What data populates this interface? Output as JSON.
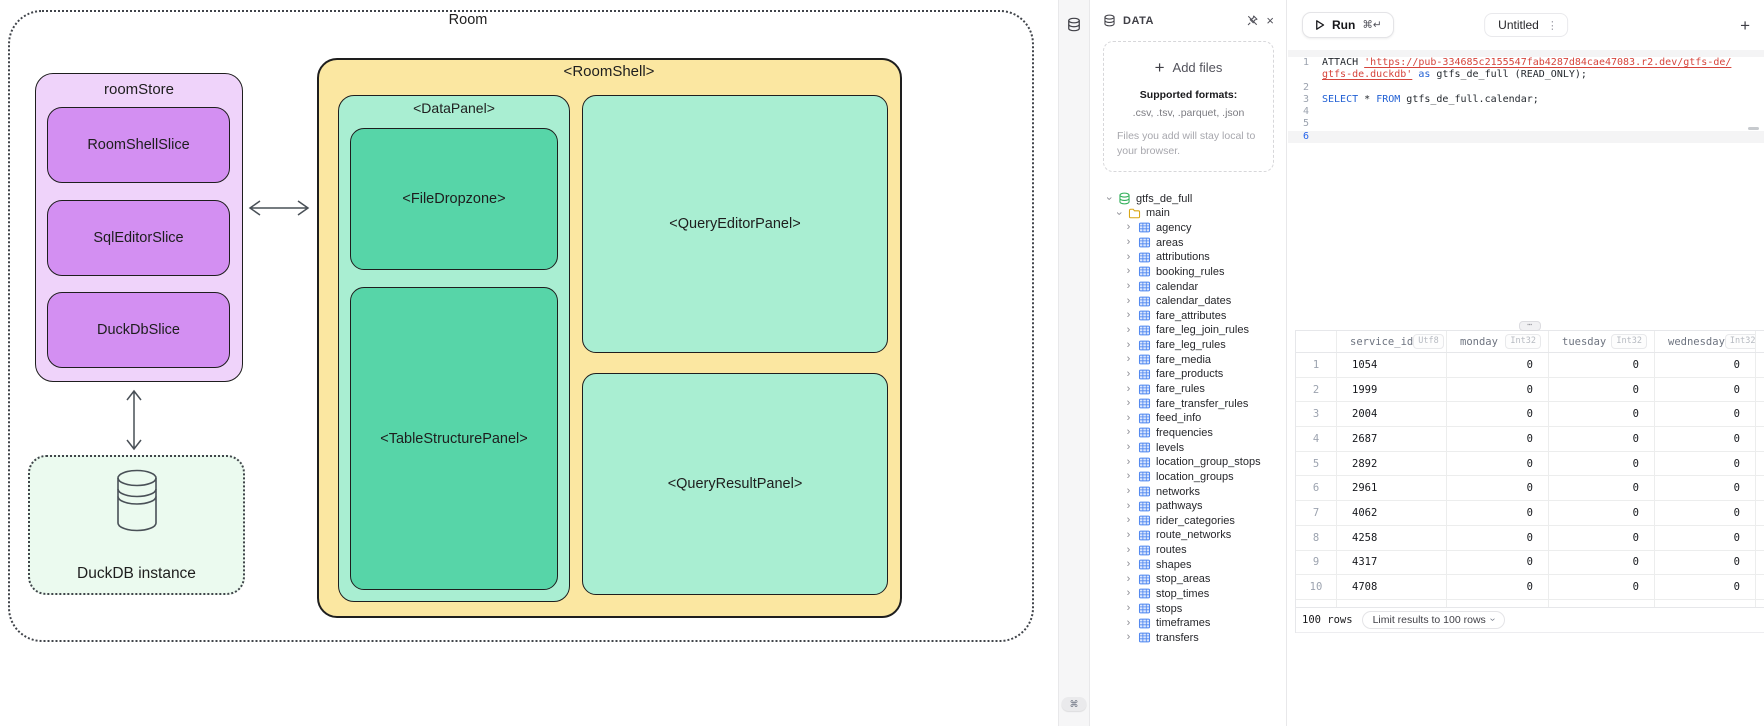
{
  "colors": {
    "d_purple_light": "#efd3fa",
    "d_purple": "#d38ff2",
    "d_yellow": "#fbe7a1",
    "d_mint": "#a9eed2",
    "d_green": "#57d5a8",
    "d_pale": "#ebfaef",
    "kw_blue": "#2160d4",
    "string_red": "#d6443c"
  },
  "icons": {
    "plus": "+",
    "close": "×",
    "dots_vertical": "⋮",
    "chevron": "›",
    "grip": "⋯",
    "cmd": "⌘"
  },
  "diagram": {
    "room_label": "Room",
    "room_store": {
      "label": "roomStore",
      "slices": [
        "RoomShellSlice",
        "SqlEditorSlice",
        "DuckDbSlice"
      ]
    },
    "duckdb_instance_label": "DuckDB instance",
    "room_shell": {
      "label": "<RoomShell>",
      "data_panel": {
        "label": "<DataPanel>",
        "file_dropzone_label": "<FileDropzone>",
        "table_structure_label": "<TableStructurePanel>"
      },
      "query_editor_label": "<QueryEditorPanel>",
      "query_result_label": "<QueryResultPanel>"
    }
  },
  "app": {
    "data_panel": {
      "title": "DATA",
      "add_files_label": "Add files",
      "supported_formats_title": "Supported formats:",
      "supported_formats": ".csv, .tsv, .parquet, .json",
      "local_note": "Files you add will stay local to your browser.",
      "tree": {
        "database": "gtfs_de_full",
        "schema": "main",
        "tables": [
          "agency",
          "areas",
          "attributions",
          "booking_rules",
          "calendar",
          "calendar_dates",
          "fare_attributes",
          "fare_leg_join_rules",
          "fare_leg_rules",
          "fare_media",
          "fare_products",
          "fare_rules",
          "fare_transfer_rules",
          "feed_info",
          "frequencies",
          "levels",
          "location_group_stops",
          "location_groups",
          "networks",
          "pathways",
          "rider_categories",
          "route_networks",
          "routes",
          "shapes",
          "stop_areas",
          "stop_times",
          "stops",
          "timeframes",
          "transfers"
        ]
      }
    },
    "editor": {
      "run_label": "Run",
      "run_shortcut": "⌘↵",
      "tab_title": "Untitled",
      "lines": [
        {
          "num": "1",
          "active": false,
          "segments": [
            {
              "t": "ATTACH ",
              "c": "p"
            },
            {
              "t": "'https://pub-334685c2155547fab4287d84cae47083.r2.dev/gtfs-de/",
              "c": "s"
            }
          ]
        },
        {
          "num": "",
          "active": false,
          "segments": [
            {
              "t": "gtfs-de.duckdb'",
              "c": "s"
            },
            {
              "t": " ",
              "c": "p"
            },
            {
              "t": "as",
              "c": "k"
            },
            {
              "t": " gtfs_de_full (READ_ONLY);",
              "c": "p"
            }
          ]
        },
        {
          "num": "2",
          "active": false,
          "segments": []
        },
        {
          "num": "3",
          "active": false,
          "segments": [
            {
              "t": "SELECT",
              "c": "k"
            },
            {
              "t": " * ",
              "c": "p"
            },
            {
              "t": "FROM",
              "c": "k"
            },
            {
              "t": " gtfs_de_full.calendar;",
              "c": "p"
            }
          ]
        },
        {
          "num": "4",
          "active": false,
          "segments": []
        },
        {
          "num": "5",
          "active": false,
          "segments": []
        },
        {
          "num": "6",
          "active": true,
          "segments": []
        }
      ]
    },
    "results": {
      "columns": [
        {
          "name": "service_id",
          "type": "Utf8",
          "align": "left"
        },
        {
          "name": "monday",
          "type": "Int32",
          "align": "right"
        },
        {
          "name": "tuesday",
          "type": "Int32",
          "align": "right"
        },
        {
          "name": "wednesday",
          "type": "Int32",
          "align": "right"
        }
      ],
      "rows": [
        [
          "1054",
          "0",
          "0",
          "0"
        ],
        [
          "1999",
          "0",
          "0",
          "0"
        ],
        [
          "2004",
          "0",
          "0",
          "0"
        ],
        [
          "2687",
          "0",
          "0",
          "0"
        ],
        [
          "2892",
          "0",
          "0",
          "0"
        ],
        [
          "2961",
          "0",
          "0",
          "0"
        ],
        [
          "4062",
          "0",
          "0",
          "0"
        ],
        [
          "4258",
          "0",
          "0",
          "0"
        ],
        [
          "4317",
          "0",
          "0",
          "0"
        ],
        [
          "4708",
          "0",
          "0",
          "0"
        ]
      ],
      "footer": {
        "row_count": "100 rows",
        "limit_button": "Limit results to 100 rows"
      }
    }
  }
}
